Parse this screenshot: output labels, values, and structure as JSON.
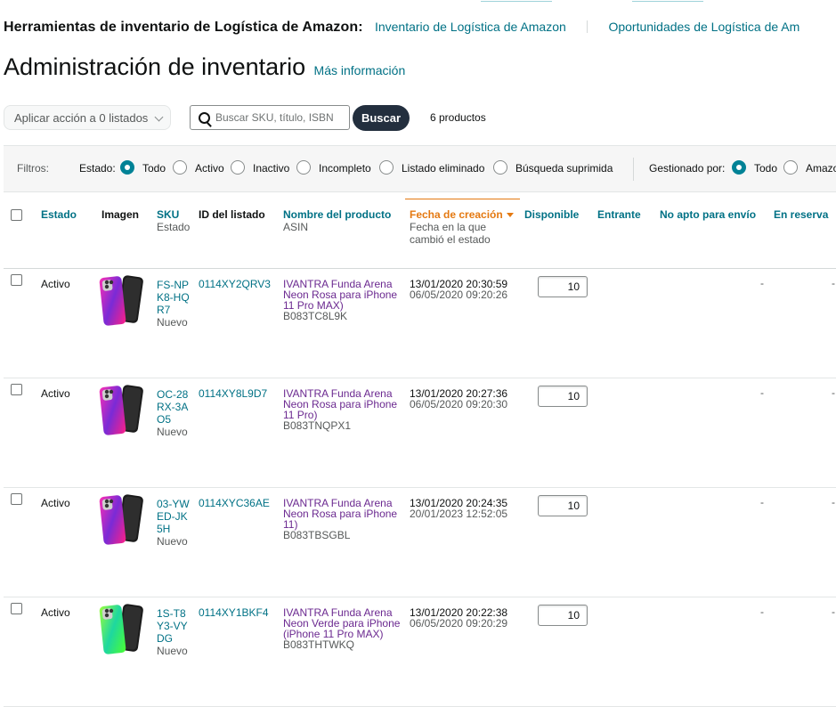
{
  "toolbar": {
    "title": "Herramientas de inventario de Logística de Amazon:",
    "link1": "Inventario de Logística de Amazon",
    "link2": "Oportunidades de Logística de Am"
  },
  "page": {
    "title": "Administración de inventario",
    "more_info": "Más información"
  },
  "actions": {
    "bulk_action": "Aplicar acción a 0 listados",
    "search_placeholder": "Buscar SKU, título, ISBN",
    "search_button": "Buscar",
    "product_count": "6 productos"
  },
  "filters": {
    "label": "Filtros:",
    "status_label": "Estado:",
    "status_options": [
      "Todo",
      "Activo",
      "Inactivo",
      "Incompleto",
      "Listado eliminado",
      "Búsqueda suprimida"
    ],
    "status_selected": "Todo",
    "managed_label": "Gestionado por:",
    "managed_options": [
      "Todo",
      "Amazo"
    ],
    "managed_selected": "Todo"
  },
  "table": {
    "headers": {
      "status": "Estado",
      "image": "Imagen",
      "sku": "SKU",
      "sku_sub": "Estado",
      "listing_id": "ID del listado",
      "product_name": "Nombre del producto",
      "product_name_sub": "ASIN",
      "created": "Fecha de creación",
      "created_sub": "Fecha en la que cambió el estado",
      "available": "Disponible",
      "inbound": "Entrante",
      "unfulfillable": "No apto para envío",
      "reserved": "En reserva"
    },
    "rows": [
      {
        "status": "Activo",
        "sku": "FS-NPK8-HQR7",
        "condition": "Nuevo",
        "listing_id": "0114XY2QRV3",
        "name": "IVANTRA Funda Arena Neon Rosa para iPhone 11 Pro MAX)",
        "asin": "B083TC8L9K",
        "created": "13/01/2020 20:30:59",
        "changed": "06/05/2020 09:20:26",
        "available": "10",
        "unfulfillable": "-",
        "reserved": "-",
        "color": "pink"
      },
      {
        "status": "Activo",
        "sku": "OC-28RX-3AO5",
        "condition": "Nuevo",
        "listing_id": "0114XY8L9D7",
        "name": "IVANTRA Funda Arena Neon Rosa para iPhone 11 Pro)",
        "asin": "B083TNQPX1",
        "created": "13/01/2020 20:27:36",
        "changed": "06/05/2020 09:20:30",
        "available": "10",
        "unfulfillable": "-",
        "reserved": "-",
        "color": "pink"
      },
      {
        "status": "Activo",
        "sku": "03-YWED-JK5H",
        "condition": "Nuevo",
        "listing_id": "0114XYC36AE",
        "name": "IVANTRA Funda Arena Neon Rosa para iPhone 11)",
        "asin": "B083TBSGBL",
        "created": "13/01/2020 20:24:35",
        "changed": "20/01/2023 12:52:05",
        "available": "10",
        "unfulfillable": "-",
        "reserved": "-",
        "color": "pink"
      },
      {
        "status": "Activo",
        "sku": "1S-T8Y3-VYDG",
        "condition": "Nuevo",
        "listing_id": "0114XY1BKF4",
        "name": "IVANTRA Funda Arena Neon Verde para iPhone (iPhone 11 Pro MAX)",
        "asin": "B083THTWKQ",
        "created": "13/01/2020 20:22:38",
        "changed": "06/05/2020 09:20:29",
        "available": "10",
        "unfulfillable": "-",
        "reserved": "-",
        "color": "green"
      }
    ]
  }
}
